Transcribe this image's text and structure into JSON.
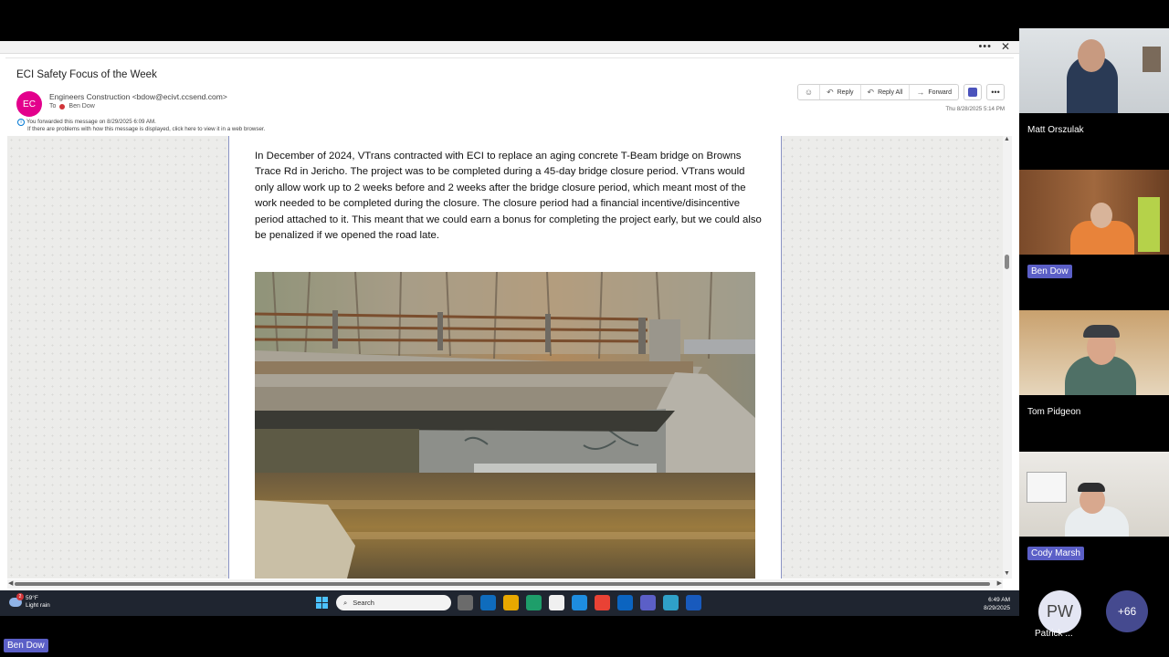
{
  "email": {
    "subject": "ECI Safety Focus of the Week",
    "avatar_initials": "EC",
    "sender": "Engineers Construction <bdow@ecivt.ccsend.com>",
    "to_label": "To",
    "recipient": "Ben Dow",
    "forwarded_note": "You forwarded this message on 8/29/2025 6:09 AM.",
    "display_note": "If there are problems with how this message is displayed, click here to view it in a web browser.",
    "timestamp": "Thu 8/28/2025 5:14 PM",
    "actions": {
      "reply": "Reply",
      "reply_all": "Reply All",
      "forward": "Forward"
    },
    "body_paragraph": "In December of 2024, VTrans contracted with ECI to replace an aging concrete T-Beam bridge on Browns Trace Rd in Jericho. The project was to be completed during a 45-day bridge closure period. VTrans would only allow work up to 2 weeks before and 2 weeks after the bridge closure period, which meant most of the work needed to be completed during the closure. The closure period had a financial incentive/disincentive period attached to it. This meant that we could earn a bonus for completing the project early, but we could also be penalized if we opened the road late."
  },
  "taskbar": {
    "temperature": "59°F",
    "weather": "Light rain",
    "weather_badge": "2",
    "search_placeholder": "Search",
    "time": "6:49 AM",
    "date": "8/29/2025",
    "app_icon_colors": [
      "#6b6b6b",
      "#0f6cbd",
      "#e8a800",
      "#1e9e6a",
      "#f0f0f0",
      "#1e8de0",
      "#e94235",
      "#0b64c0",
      "#5b5fc7",
      "#2fa0c8",
      "#185abd"
    ]
  },
  "meeting": {
    "participants": [
      {
        "name": "Matt Orszulak"
      },
      {
        "name": "Ben Dow"
      },
      {
        "name": "Tom Pidgeon"
      },
      {
        "name": "Cody Marsh"
      }
    ],
    "overflow_initials": "PW",
    "overflow_name": "Patrick ...",
    "overflow_count": "+66",
    "presenter": "Ben Dow"
  }
}
